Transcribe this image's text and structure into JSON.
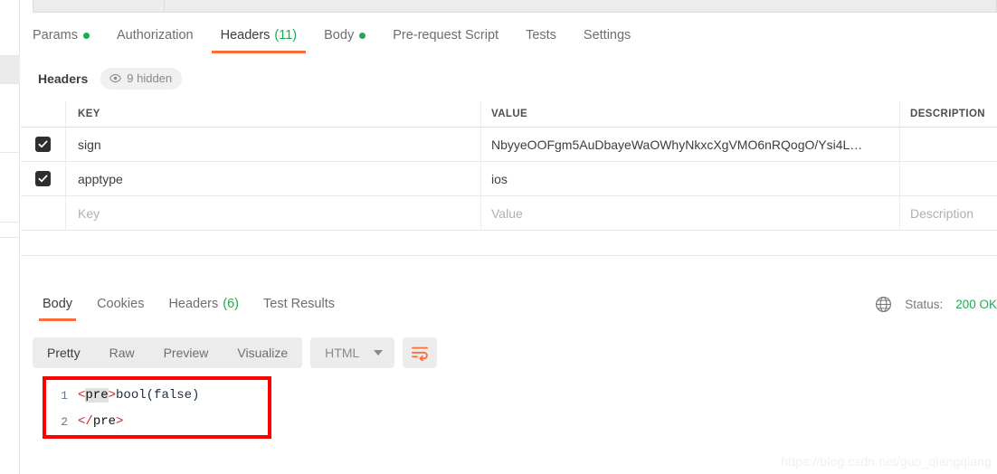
{
  "request_tabs": [
    {
      "label": "Params",
      "dot": true,
      "count": null,
      "active": false
    },
    {
      "label": "Authorization",
      "dot": false,
      "count": null,
      "active": false
    },
    {
      "label": "Headers",
      "dot": false,
      "count": "(11)",
      "active": true
    },
    {
      "label": "Body",
      "dot": true,
      "count": null,
      "active": false
    },
    {
      "label": "Pre-request Script",
      "dot": false,
      "count": null,
      "active": false
    },
    {
      "label": "Tests",
      "dot": false,
      "count": null,
      "active": false
    },
    {
      "label": "Settings",
      "dot": false,
      "count": null,
      "active": false
    }
  ],
  "headers_section": {
    "title": "Headers",
    "hidden_badge": "9 hidden",
    "eye_icon": "eye-icon"
  },
  "headers_table": {
    "columns": [
      "KEY",
      "VALUE",
      "DESCRIPTION"
    ],
    "rows": [
      {
        "checked": true,
        "key": "sign",
        "value": "NbyyeOOFgm5AuDbayeWaOWhyNkxcXgVMO6nRQogO/Ysi4L…",
        "description": ""
      },
      {
        "checked": true,
        "key": "apptype",
        "value": "ios",
        "description": ""
      }
    ],
    "placeholder_row": {
      "key": "Key",
      "value": "Value",
      "description": "Description"
    }
  },
  "response_tabs": [
    {
      "label": "Body",
      "count": null,
      "active": true
    },
    {
      "label": "Cookies",
      "count": null,
      "active": false
    },
    {
      "label": "Headers",
      "count": "(6)",
      "active": false
    },
    {
      "label": "Test Results",
      "count": null,
      "active": false
    }
  ],
  "response_status": {
    "globe_icon": "globe-icon",
    "label": "Status:",
    "value": "200 OK"
  },
  "body_toolbar": {
    "views": [
      {
        "label": "Pretty",
        "active": true
      },
      {
        "label": "Raw",
        "active": false
      },
      {
        "label": "Preview",
        "active": false
      },
      {
        "label": "Visualize",
        "active": false
      }
    ],
    "format_selected": "HTML",
    "caret_icon": "chevron-down-icon",
    "wrap_icon": "wrap-text-icon"
  },
  "code": {
    "lines": [
      {
        "number": "1",
        "tokens": [
          {
            "text": "<",
            "style": "tag-br"
          },
          {
            "text": "pre",
            "style": "tag-nm"
          },
          {
            "text": ">",
            "style": "tag-br"
          },
          {
            "text": "bool(false)",
            "style": "plain"
          }
        ]
      },
      {
        "number": "2",
        "tokens": [
          {
            "text": "</",
            "style": "tag-br"
          },
          {
            "text": "pre",
            "style": "tag-nm2"
          },
          {
            "text": ">",
            "style": "tag-br"
          }
        ]
      }
    ]
  },
  "annotation": {
    "color": "#fe0000"
  },
  "watermark": "https://blog.csdn.net/guo_qiangqiang"
}
